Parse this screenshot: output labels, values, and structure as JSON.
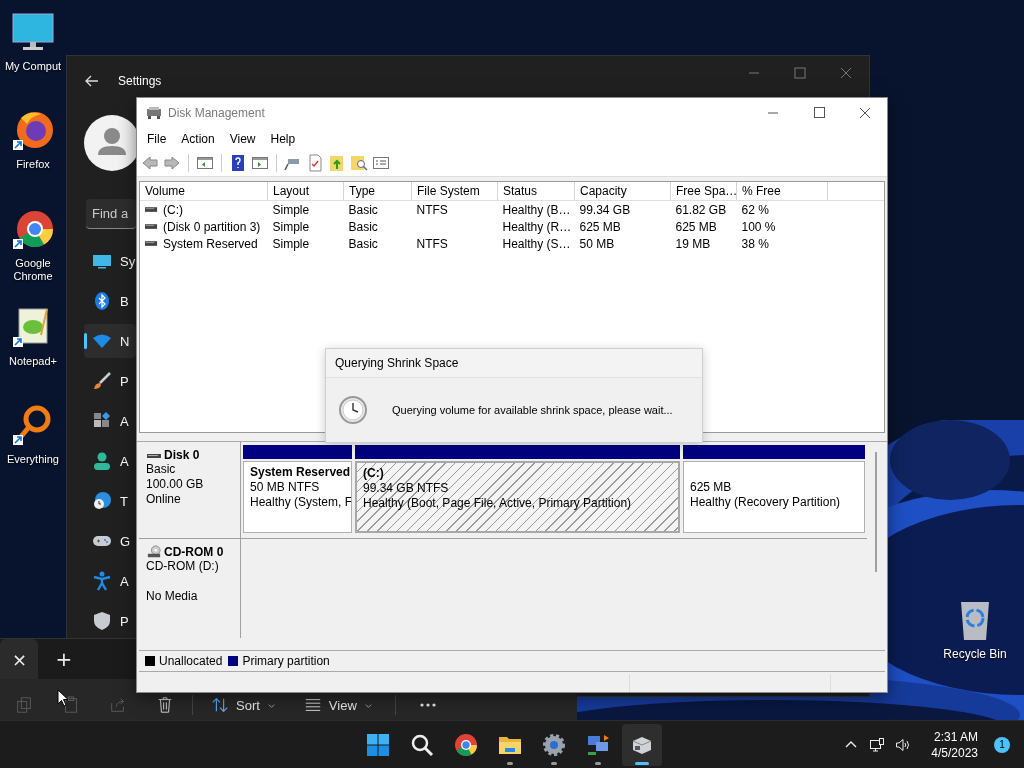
{
  "desktop_icons": [
    {
      "label": "My Comput",
      "kind": "computer"
    },
    {
      "label": "Firefox",
      "kind": "firefox"
    },
    {
      "label": "Google Chrome",
      "kind": "chrome"
    },
    {
      "label": "Notepad+",
      "kind": "notepad"
    },
    {
      "label": "Everything",
      "kind": "everything"
    }
  ],
  "recycle_bin": {
    "label": "Recycle Bin"
  },
  "settings": {
    "title": "Settings",
    "search_placeholder": "Find a",
    "nav": [
      {
        "label": "Sy",
        "kind": "system",
        "selected": false
      },
      {
        "label": "B",
        "kind": "bluetooth",
        "selected": false
      },
      {
        "label": "N",
        "kind": "network",
        "selected": true
      },
      {
        "label": "P",
        "kind": "personalization",
        "selected": false
      },
      {
        "label": "A",
        "kind": "apps",
        "selected": false
      },
      {
        "label": "A",
        "kind": "accounts",
        "selected": false
      },
      {
        "label": "T",
        "kind": "time",
        "selected": false
      },
      {
        "label": "G",
        "kind": "gaming",
        "selected": false
      },
      {
        "label": "A",
        "kind": "accessibility",
        "selected": false
      },
      {
        "label": "P",
        "kind": "privacy",
        "selected": false
      }
    ]
  },
  "explorer": {
    "tabs": [
      {
        "label": "×",
        "kind": "close"
      },
      {
        "label": "+",
        "kind": "new"
      }
    ],
    "toolbar": [
      {
        "kind": "copy",
        "disabled": true
      },
      {
        "kind": "paste",
        "disabled": true
      },
      {
        "kind": "share",
        "disabled": true
      },
      {
        "kind": "delete",
        "disabled": false
      },
      {
        "kind": "sort",
        "label": "Sort",
        "disabled": false
      },
      {
        "kind": "view",
        "label": "View",
        "disabled": false
      },
      {
        "kind": "more",
        "disabled": false
      }
    ]
  },
  "disk_management": {
    "title": "Disk Management",
    "menu": [
      "File",
      "Action",
      "View",
      "Help"
    ],
    "columns": [
      "Volume",
      "Layout",
      "Type",
      "File System",
      "Status",
      "Capacity",
      "Free Spa…",
      "% Free"
    ],
    "rows": [
      {
        "cells": [
          "(C:)",
          "Simple",
          "Basic",
          "NTFS",
          "Healthy (B…",
          "99.34 GB",
          "61.82 GB",
          "62 %"
        ]
      },
      {
        "cells": [
          "(Disk 0 partition 3)",
          "Simple",
          "Basic",
          null,
          "Healthy (R…",
          "625 MB",
          "625 MB",
          "100 %"
        ]
      },
      {
        "cells": [
          "System Reserved",
          "Simple",
          "Basic",
          "NTFS",
          "Healthy (S…",
          "50 MB",
          "19 MB",
          "38 %"
        ]
      }
    ],
    "disks": [
      {
        "kind": "disk",
        "name": "Disk 0",
        "details": [
          "Basic",
          "100.00 GB",
          "Online"
        ],
        "partitions": [
          {
            "name": "System Reserved",
            "size": "50 MB NTFS",
            "status": "Healthy (System, F",
            "selected": false
          },
          {
            "name": "(C:)",
            "size": "99.34 GB NTFS",
            "status": "Healthy (Boot, Page File, Active, Primary Partition)",
            "selected": true
          },
          {
            "size": "625 MB",
            "status": "Healthy (Recovery Partition)",
            "selected": false
          }
        ]
      },
      {
        "kind": "cdrom",
        "name": "CD-ROM 0",
        "details": [
          "CD-ROM (D:)",
          "No Media"
        ]
      }
    ],
    "legend": [
      {
        "label": "Unallocated",
        "color": "#000000"
      },
      {
        "label": "Primary partition",
        "color": "#000080"
      }
    ],
    "dialog": {
      "title": "Querying Shrink Space",
      "message": "Querying volume for available shrink space, please wait..."
    }
  },
  "taskbar": {
    "apps": [
      {
        "kind": "start",
        "running": false,
        "selected": false
      },
      {
        "kind": "search",
        "running": false,
        "selected": false
      },
      {
        "kind": "chrome",
        "running": false,
        "selected": false
      },
      {
        "kind": "explorer",
        "running": true,
        "selected": false
      },
      {
        "kind": "settings",
        "running": true,
        "selected": false
      },
      {
        "kind": "network",
        "running": true,
        "selected": false
      },
      {
        "kind": "diskmgmt",
        "running": true,
        "selected": true
      }
    ],
    "time": "2:31 AM",
    "date": "4/5/2023",
    "badge": "1"
  }
}
